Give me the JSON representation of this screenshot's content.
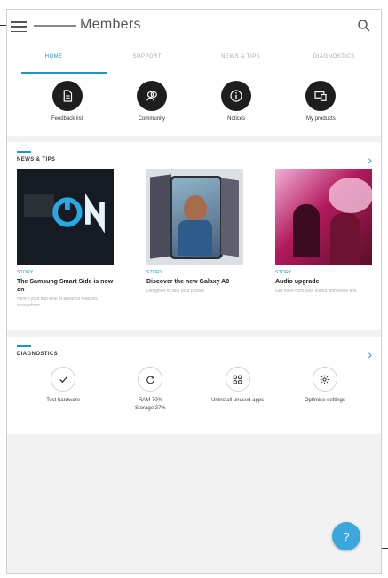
{
  "app": {
    "title": "Members"
  },
  "tabs": [
    {
      "label": "HOME",
      "active": true
    },
    {
      "label": "SUPPORT",
      "active": false
    },
    {
      "label": "NEWS & TIPS",
      "active": false
    },
    {
      "label": "DIAGNOSTICS",
      "active": false
    }
  ],
  "quick_actions": [
    {
      "label": "Feedback list",
      "icon": "document-icon"
    },
    {
      "label": "Community",
      "icon": "people-icon"
    },
    {
      "label": "Notices",
      "icon": "info-icon"
    },
    {
      "label": "My products",
      "icon": "devices-icon"
    }
  ],
  "news": {
    "title": "NEWS & TIPS",
    "cards": [
      {
        "tag": "STORY",
        "title": "The Samsung Smart Side is now on",
        "subtitle": "Here's your first look at advance features everywhere"
      },
      {
        "tag": "STORY",
        "title": "Discover the new Galaxy A8",
        "subtitle": "Designed to take your photos"
      },
      {
        "tag": "STORY",
        "title": "Audio upgrade",
        "subtitle": "Get more from your sound with these tips"
      }
    ]
  },
  "diagnostics": {
    "title": "DIAGNOSTICS",
    "items": [
      {
        "label": "Test hardware",
        "icon": "check-icon"
      },
      {
        "label": "RAM 70%\nStorage 37%",
        "icon": "refresh-icon"
      },
      {
        "label": "Uninstall unused apps",
        "icon": "apps-grid-icon"
      },
      {
        "label": "Optimise settings",
        "icon": "settings-icon"
      }
    ]
  },
  "fab": {
    "label": "?"
  },
  "colors": {
    "accent": "#1a96c9",
    "fab": "#3aa8dc",
    "icon_circle": "#1e1e1e"
  }
}
